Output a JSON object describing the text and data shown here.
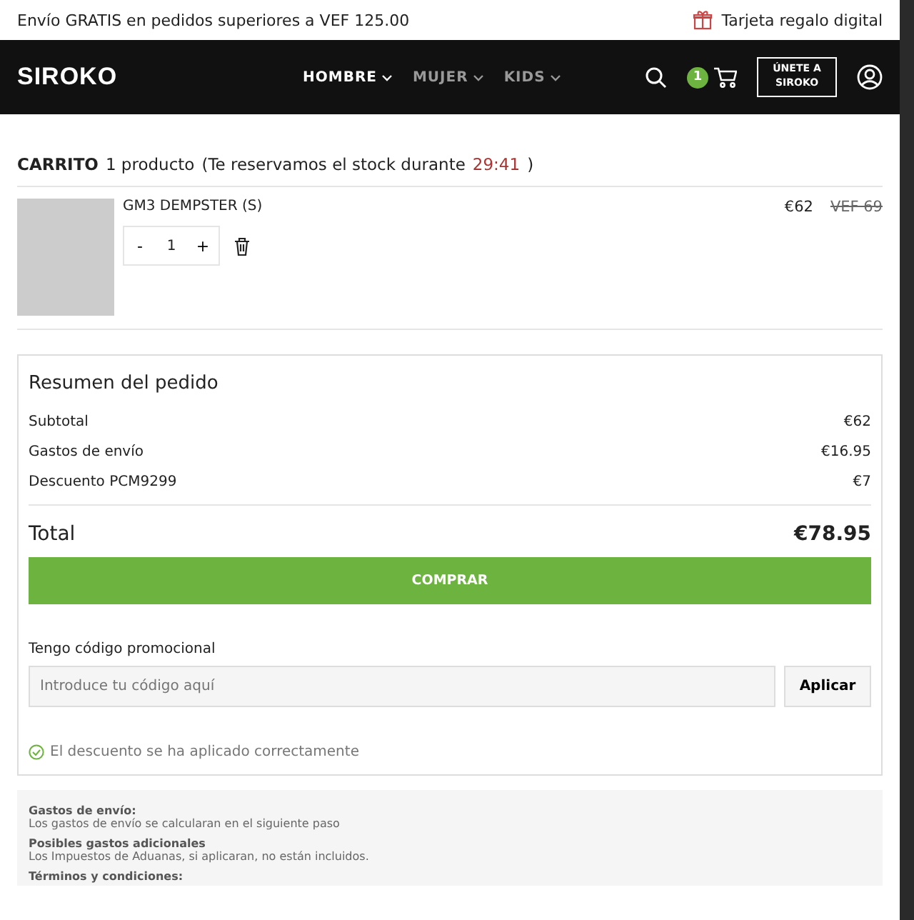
{
  "promo_bar": {
    "shipping": "Envío GRATIS en pedidos superiores a VEF 125.00",
    "gift_card": "Tarjeta regalo digital"
  },
  "header": {
    "logo": "SIROKO",
    "nav": [
      {
        "label": "HOMBRE",
        "selected": true
      },
      {
        "label": "MUJER",
        "selected": false
      },
      {
        "label": "KIDS",
        "selected": false
      }
    ],
    "cart_count": "1",
    "join_button": "ÚNETE A SIROKO"
  },
  "cart": {
    "title": "CARRITO",
    "count": "1 producto",
    "reserve_text": "(Te reservamos el stock durante",
    "timer": "29:41",
    "reserve_end": ")",
    "items": [
      {
        "name": "GM3 DEMPSTER (S)",
        "price": "€62",
        "old_price": "VEF 69",
        "quantity": "1",
        "minus": "-",
        "plus": "+"
      }
    ]
  },
  "summary": {
    "title": "Resumen del pedido",
    "lines": [
      {
        "label": "Subtotal",
        "value": "€62"
      },
      {
        "label": "Gastos de envío",
        "value": "€16.95"
      },
      {
        "label": "Descuento PCM9299",
        "value": "€7"
      }
    ],
    "total_label": "Total",
    "total_value": "€78.95",
    "buy_button": "COMPRAR",
    "promo_label": "Tengo código promocional",
    "promo_placeholder": "Introduce tu código aquí",
    "apply_button": "Aplicar",
    "success": "El descuento se ha aplicado correctamente"
  },
  "info": [
    {
      "title": "Gastos de envío:",
      "text": "Los gastos de envío se calcularan en el siguiente paso"
    },
    {
      "title": "Posibles gastos adicionales",
      "text": "Los Impuestos de Aduanas, si aplicaran, no están incluidos."
    },
    {
      "title": "Términos y condiciones:"
    }
  ]
}
